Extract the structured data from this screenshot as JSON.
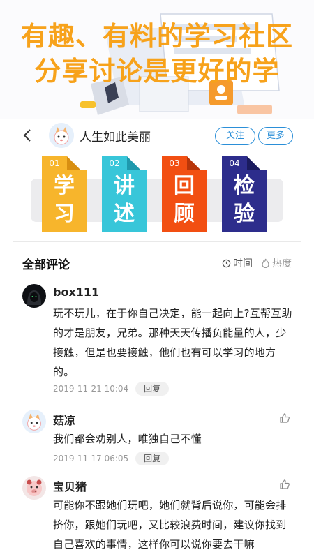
{
  "banner": {
    "line1": "有趣、有料的学习社区",
    "line2": "分享讨论是更好的学"
  },
  "header": {
    "author_name": "人生如此美丽",
    "follow_label": "关注",
    "more_label": "更多"
  },
  "cards": [
    {
      "num": "01",
      "c1": "学",
      "c2": "习",
      "color": "#f7b52c",
      "fold": "#d88f12"
    },
    {
      "num": "02",
      "c1": "讲",
      "c2": "述",
      "color": "#38c6d9",
      "fold": "#1f99ad"
    },
    {
      "num": "03",
      "c1": "回",
      "c2": "顾",
      "color": "#f24f12",
      "fold": "#b8360a"
    },
    {
      "num": "04",
      "c1": "检",
      "c2": "验",
      "color": "#2d2d8c",
      "fold": "#1b1b5e"
    }
  ],
  "comments_section": {
    "title": "全部评论",
    "sort_time": "时间",
    "sort_hot": "热度"
  },
  "comments": [
    {
      "name": "box111",
      "text": "玩不玩儿，在于你自己决定，能一起向上?互帮互助的才是朋友，兄弟。那种天天传播负能量的人，少接触，但是也要接触，他们也有可以学习的地方的。",
      "time": "2019-11-21 10:04",
      "reply": "回复"
    },
    {
      "name": "菇凉",
      "text": "我们都会劝别人，唯独自己不懂",
      "time": "2019-11-17 06:05",
      "reply": "回复"
    },
    {
      "name": "宝贝猪",
      "text": "可能你不跟她们玩吧，她们就背后说你，可能会排挤你，跟她们玩吧，又比较浪费时间，建议你找到自己喜欢的事情，这样你可以说你要去干嘛",
      "time": "",
      "reply": ""
    }
  ]
}
